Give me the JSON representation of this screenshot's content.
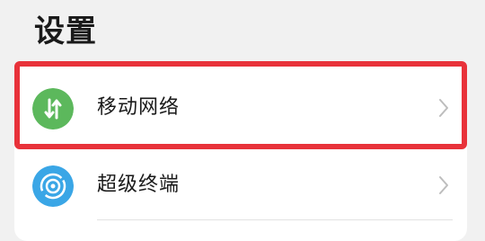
{
  "header": {
    "title": "设置"
  },
  "settings_list": {
    "items": [
      {
        "label": "移动网络",
        "icon": "mobile-data-icon",
        "icon_color": "#5cb85c",
        "chevron": "chevron-right-icon"
      },
      {
        "label": "超级终端",
        "icon": "super-device-icon",
        "icon_color": "#3aa6e6",
        "chevron": "chevron-right-icon"
      }
    ]
  },
  "annotation": {
    "highlight_color": "#e8323a",
    "highlighted_item": "移动网络"
  }
}
